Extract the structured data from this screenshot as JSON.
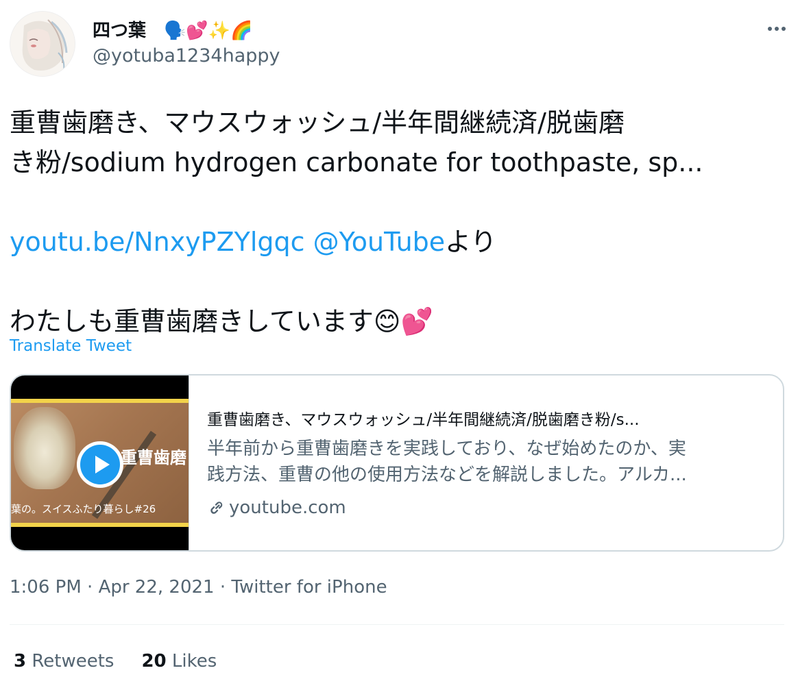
{
  "user": {
    "display_name": "四つ葉",
    "name_emoji": "🗣️💕✨🌈",
    "handle": "@yotuba1234happy"
  },
  "tweet": {
    "text_line1": "重曹歯磨き、マウスウォッシュ/半年間継続済/脱歯磨",
    "text_line2": "き粉/sodium hydrogen carbonate for toothpaste, sp...",
    "link_url": "youtu.be/NnxyPZYlgqc",
    "mention": "@YouTube",
    "after_link": "より",
    "closing": "わたしも重曹歯磨きしています",
    "closing_emoji": "😊💕"
  },
  "translate_label": "Translate Tweet",
  "card": {
    "title": "重曹歯磨き、マウスウォッシュ/半年間継続済/脱歯磨き粉/s...",
    "desc_line1": "半年前から重曹歯磨きを実践しており、なぜ始めたのか、実",
    "desc_line2": "践方法、重曹の他の使用方法などを解説しました。アルカ...",
    "domain": "youtube.com",
    "thumb_title": "重曹歯磨",
    "thumb_caption": "葉の。スイスふたり暮らし#26"
  },
  "meta": {
    "time": "1:06 PM",
    "date": "Apr 22, 2021",
    "source": "Twitter for iPhone",
    "sep": " · "
  },
  "stats": {
    "retweets_count": "3",
    "retweets_label": "Retweets",
    "likes_count": "20",
    "likes_label": "Likes"
  },
  "colors": {
    "link": "#1d9bf0",
    "secondary": "#536471",
    "border": "#cfd9de"
  }
}
